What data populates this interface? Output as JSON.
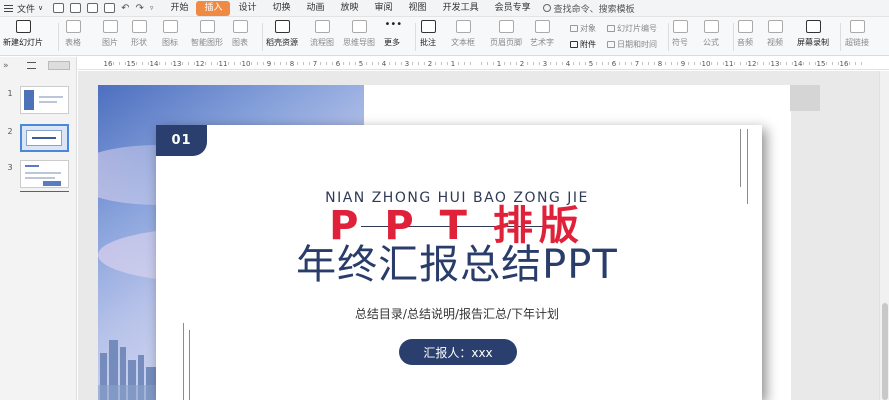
{
  "menubar": {
    "file_label": "文件",
    "tabs": [
      "开始",
      "插入",
      "设计",
      "切换",
      "动画",
      "放映",
      "审阅",
      "视图",
      "开发工具",
      "会员专享"
    ],
    "active_tab": "插入",
    "search_placeholder": "查找命令、搜索模板",
    "quick_access": [
      "保存",
      "输出为PDF",
      "打印",
      "打印预览",
      "撤销",
      "恢复"
    ]
  },
  "ribbon": {
    "new_slide": "新建幻灯片",
    "table": "表格",
    "picture": "图片",
    "shape": "形状",
    "icon": "图标",
    "smartart": "智能图形",
    "chart": "图表",
    "docer": "稻壳资源",
    "flowchart": "流程图",
    "mindmap": "思维导图",
    "more": "更多",
    "comment": "批注",
    "textbox": "文本框",
    "header_footer": "页眉页脚",
    "wordart": "艺术字",
    "object": "对象",
    "attachment": "附件",
    "slide_number": "幻灯片编号",
    "datetime": "日期和时间",
    "symbol": "符号",
    "formula": "公式",
    "audio": "音频",
    "video": "视频",
    "screen_record": "屏幕录制",
    "hyperlink": "超链接"
  },
  "left_panel": {
    "collapse_icon": "»",
    "slide_numbers": [
      "1",
      "2",
      "3"
    ],
    "selected_slide": "2"
  },
  "ruler": {
    "labels": [
      "16",
      "15",
      "14",
      "13",
      "12",
      "11",
      "10",
      "9",
      "8",
      "7",
      "6",
      "5",
      "4",
      "3",
      "2",
      "1",
      "",
      "1",
      "2",
      "3",
      "4",
      "5",
      "6",
      "7",
      "8",
      "9",
      "10",
      "11",
      "12",
      "13",
      "14",
      "15",
      "16"
    ]
  },
  "slide": {
    "tag": "01",
    "pinyin": "NIAN ZHONG HUI BAO ZONG JIE",
    "overlay_title": "P P T 排版",
    "main_title": "年终汇报总结PPT",
    "subtitle": "总结目录/总结说明/报告汇总/下年计划",
    "reporter": "汇报人：xxx"
  },
  "colors": {
    "navy": "#2a3f6d",
    "red": "#e0213a",
    "active_tab": "#f08a43"
  }
}
